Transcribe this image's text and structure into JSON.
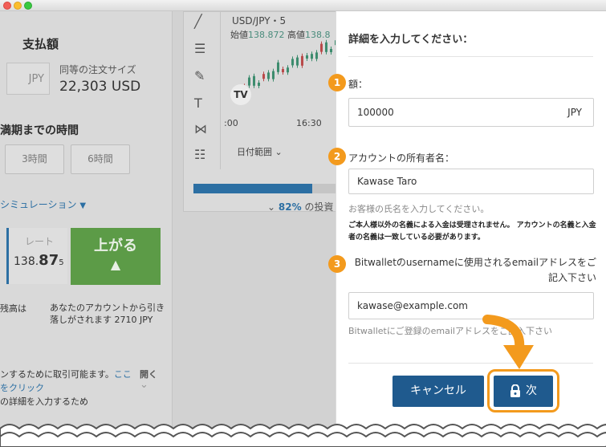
{
  "left": {
    "payment_label": "支払額",
    "currency": "JPY",
    "equiv_order_size_label": "同等の注文サイズ",
    "equiv_order_size_value": "22,303 USD",
    "time_to_expiry_label": "満期までの時間",
    "duration_options": [
      "3時間",
      "6時間"
    ],
    "simulation_label": "シミュレーション",
    "rate_label": "レート",
    "rate_prefix": "138.",
    "rate_big": "87",
    "rate_small": "5",
    "up_button_label": "上がる",
    "balance_label": "残高は",
    "balance_text": "あなたのアカウントから引き落しがされます 2710 JPY",
    "notice_text": "ンするために取引可能ます。",
    "notice_link": "ここをクリック",
    "notice_tail": "の詳細を入力するため",
    "open_label": "開く"
  },
  "chart": {
    "symbol": "USD/JPY・5",
    "open_label": "始値",
    "open_value": "138.872",
    "high_label": "高値",
    "high_value": "138.8",
    "time_ticks": [
      ":00",
      "16:30"
    ],
    "date_range_label": "日付範囲",
    "progress_fraction": 0.82,
    "investors_percent": "82%",
    "investors_text": "の投資"
  },
  "form": {
    "title": "詳細を入力してください：",
    "amount": {
      "step": "1",
      "label": "額：",
      "value": "100000",
      "unit": "JPY"
    },
    "holder": {
      "step": "2",
      "label": "アカウントの所有者名：",
      "value": "Kawase Taro",
      "hint": "お客様の氏名を入力してください。"
    },
    "warning": "ご本人様以外の名義による入金は受理されません。 アカウントの名義と入金者の名義は一致している必要があります。",
    "email": {
      "step": "3",
      "label": "Bitwalletのusernameに使用されるemailアドレスをご記入下さい",
      "value": "kawase@example.com",
      "hint": "Bitwalletにご登録のemailアドレスをご記入下さい"
    },
    "cancel_label": "キャンセル",
    "next_label": "次"
  },
  "colors": {
    "accent_orange": "#f39a1d",
    "button_blue": "#1f5a8e",
    "green_up": "#5c9b47"
  }
}
